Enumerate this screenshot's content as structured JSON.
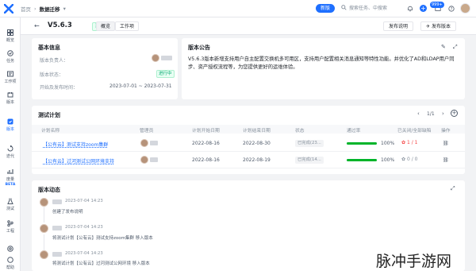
{
  "topbar": {
    "crumbs": [
      "首页",
      "数据迁移"
    ],
    "pill": "新版",
    "search_placeholder": "搜索任务、中搜索",
    "news_badge": "999+"
  },
  "nav": [
    {
      "label": "概览",
      "icon": "grid-icon"
    },
    {
      "label": "任务",
      "icon": "task-icon"
    },
    {
      "label": "工作项",
      "icon": "workitem-icon"
    },
    {
      "label": "版本",
      "icon": "version-icon"
    },
    {
      "label": "版本",
      "icon": "version-active-icon",
      "active": true
    },
    {
      "label": "迭代",
      "icon": "iteration-icon"
    },
    {
      "label": "度量",
      "icon": "metric-icon",
      "badge": "BETA"
    },
    {
      "label": "测试",
      "icon": "test-icon"
    },
    {
      "label": "工程",
      "icon": "repo-icon"
    },
    {
      "label": "设置",
      "icon": "settings-icon"
    },
    {
      "label": "帮助",
      "icon": "help-icon"
    }
  ],
  "header": {
    "version": "V5.6.3",
    "status": "进行中",
    "tabs": [
      "概览",
      "工作项"
    ],
    "publish_btn": "发布说明",
    "publish_version_btn": "发布版本"
  },
  "basic_info": {
    "title": "基本信息",
    "owner_label": "版本负责人：",
    "status_label": "版本状态：",
    "status_value": "进行中",
    "date_label": "开始及发布时间：",
    "date_value": "2023-07-01 ~ 2023-07-31"
  },
  "announcement": {
    "title": "版本公告",
    "text": "V5.6.3版本新增支持用户自主配置交换机多可用区，支持用户配置相关消息通知等特性功能。并优化了AD和LDAP用户同步、资产授权流程等，为您提供更好的运维体验。"
  },
  "test_plan": {
    "title": "测试计划",
    "pager": "1/1",
    "columns": [
      "计划名称",
      "管理员",
      "计划开始日期",
      "计划结束日期",
      "状态",
      "通过率",
      "已关闭/全部缺陷",
      "操作"
    ],
    "rows": [
      {
        "name": "【公有云】测试支持zoom集群",
        "start": "2022-08-16",
        "end": "2022-08-30",
        "status": "已完成(23...",
        "rate": 100,
        "rate_text": "100%",
        "bugs": "1 / 1",
        "bug_color": "#f53f3f"
      },
      {
        "name": "【公有云】过河测试公网环境支持",
        "start": "2022-08-16",
        "end": "2022-08-19",
        "status": "已完成(14...",
        "rate": 100,
        "rate_text": "100%",
        "bugs": "0 / 0",
        "bug_color": "#86909c"
      }
    ]
  },
  "activity": {
    "title": "版本动态",
    "items": [
      {
        "time": "2023-07-04 14:23",
        "text": "创建了发布说明"
      },
      {
        "time": "2023-07-04 14:23",
        "text": "将测试计划【公有云】测试支持zoom集群 移入版本"
      },
      {
        "time": "2023-07-04 14:23",
        "text": "将测试计划【公有云】过河测试公网环境 移入版本"
      }
    ]
  },
  "watermark": "脉冲手游网"
}
